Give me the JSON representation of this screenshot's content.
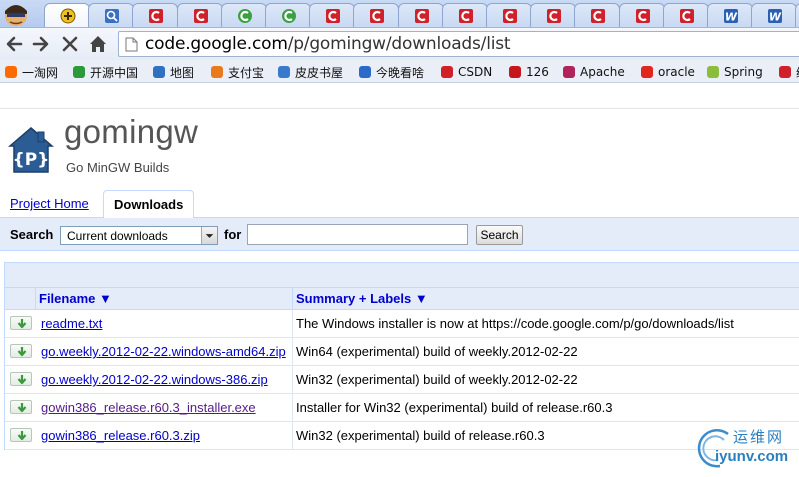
{
  "browser": {
    "tabs": [
      {
        "icon": "add-on-icon",
        "color": "#f0c020"
      },
      {
        "icon": "search-icon",
        "color": "#3a6fc4"
      },
      {
        "icon": "csdn-icon",
        "color": "#d0202a"
      },
      {
        "icon": "csdn-icon",
        "color": "#d0202a"
      },
      {
        "icon": "chrome-c-icon",
        "color": "#3aa040"
      },
      {
        "icon": "chrome-c-icon",
        "color": "#3aa040"
      },
      {
        "icon": "csdn-icon",
        "color": "#d0202a"
      },
      {
        "icon": "csdn-icon",
        "color": "#d0202a"
      },
      {
        "icon": "csdn-icon",
        "color": "#d0202a"
      },
      {
        "icon": "csdn-icon",
        "color": "#d0202a"
      },
      {
        "icon": "csdn-icon",
        "color": "#d0202a"
      },
      {
        "icon": "csdn-icon",
        "color": "#d0202a"
      },
      {
        "icon": "csdn-icon",
        "color": "#d0202a"
      },
      {
        "icon": "csdn-icon",
        "color": "#d0202a"
      },
      {
        "icon": "csdn-icon",
        "color": "#d0202a"
      },
      {
        "icon": "word-w-icon",
        "color": "#2b5fb4"
      },
      {
        "icon": "word-w-icon",
        "color": "#2b5fb4"
      },
      {
        "icon": "word-w-icon",
        "color": "#2b5fb4"
      }
    ],
    "url_host": "code.google.com",
    "url_path": "/p/gomingw/downloads/list",
    "bookmarks": [
      {
        "label": "一淘网",
        "icon": "etao-icon",
        "color": "#ff6a00"
      },
      {
        "label": "开源中国",
        "icon": "oschina-icon",
        "color": "#2a9a3a"
      },
      {
        "label": "地图",
        "icon": "map-icon",
        "color": "#3070c0"
      },
      {
        "label": "支付宝",
        "icon": "alipay-icon",
        "color": "#e87a1c"
      },
      {
        "label": "皮皮书屋",
        "icon": "book-icon",
        "color": "#3a7acc"
      },
      {
        "label": "今晚看啥",
        "icon": "play-icon",
        "color": "#2a6ac8"
      },
      {
        "label": "CSDN",
        "icon": "csdn-icon",
        "color": "#d0202a"
      },
      {
        "label": "126",
        "icon": "netease-icon",
        "color": "#c8161d"
      },
      {
        "label": "Apache",
        "icon": "apache-feather-icon",
        "color": "#b0245a"
      },
      {
        "label": "oracle",
        "icon": "oracle-icon",
        "color": "#e1261c"
      },
      {
        "label": "Spring",
        "icon": "spring-leaf-icon",
        "color": "#8abd3a"
      },
      {
        "label": "编",
        "icon": "cnblogs-icon",
        "color": "#d0202a"
      }
    ]
  },
  "project": {
    "name": "gomingw",
    "summary": "Go MinGW Builds"
  },
  "tabs": {
    "project_home": "Project Home",
    "downloads": "Downloads"
  },
  "search": {
    "label": "Search",
    "scope": "Current downloads",
    "for_label": "for",
    "query": "",
    "button": "Search"
  },
  "table": {
    "col_filename": "Filename ▼",
    "col_summary": "Summary + Labels ▼",
    "rows": [
      {
        "filename": "readme.txt",
        "summary": "The Windows installer is now at https://code.google.com/p/go/downloads/list",
        "visited": false
      },
      {
        "filename": "go.weekly.2012-02-22.windows-amd64.zip",
        "summary": "Win64 (experimental) build of weekly.2012-02-22",
        "visited": false
      },
      {
        "filename": "go.weekly.2012-02-22.windows-386.zip",
        "summary": "Win32 (experimental) build of weekly.2012-02-22",
        "visited": false
      },
      {
        "filename": "gowin386_release.r60.3_installer.exe",
        "summary": "Installer for Win32 (experimental) build of release.r60.3",
        "visited": true
      },
      {
        "filename": "gowin386_release.r60.3.zip",
        "summary": "Win32 (experimental) build of release.r60.3",
        "visited": false
      }
    ]
  },
  "watermark": {
    "top": "运维网",
    "bottom": "iyunv.com"
  },
  "colors": {
    "link": "#0000cc",
    "visited": "#551a8b",
    "header_bg": "#e5ecf9",
    "border": "#c3d9ff",
    "download_arrow": "#3a9a3a"
  }
}
